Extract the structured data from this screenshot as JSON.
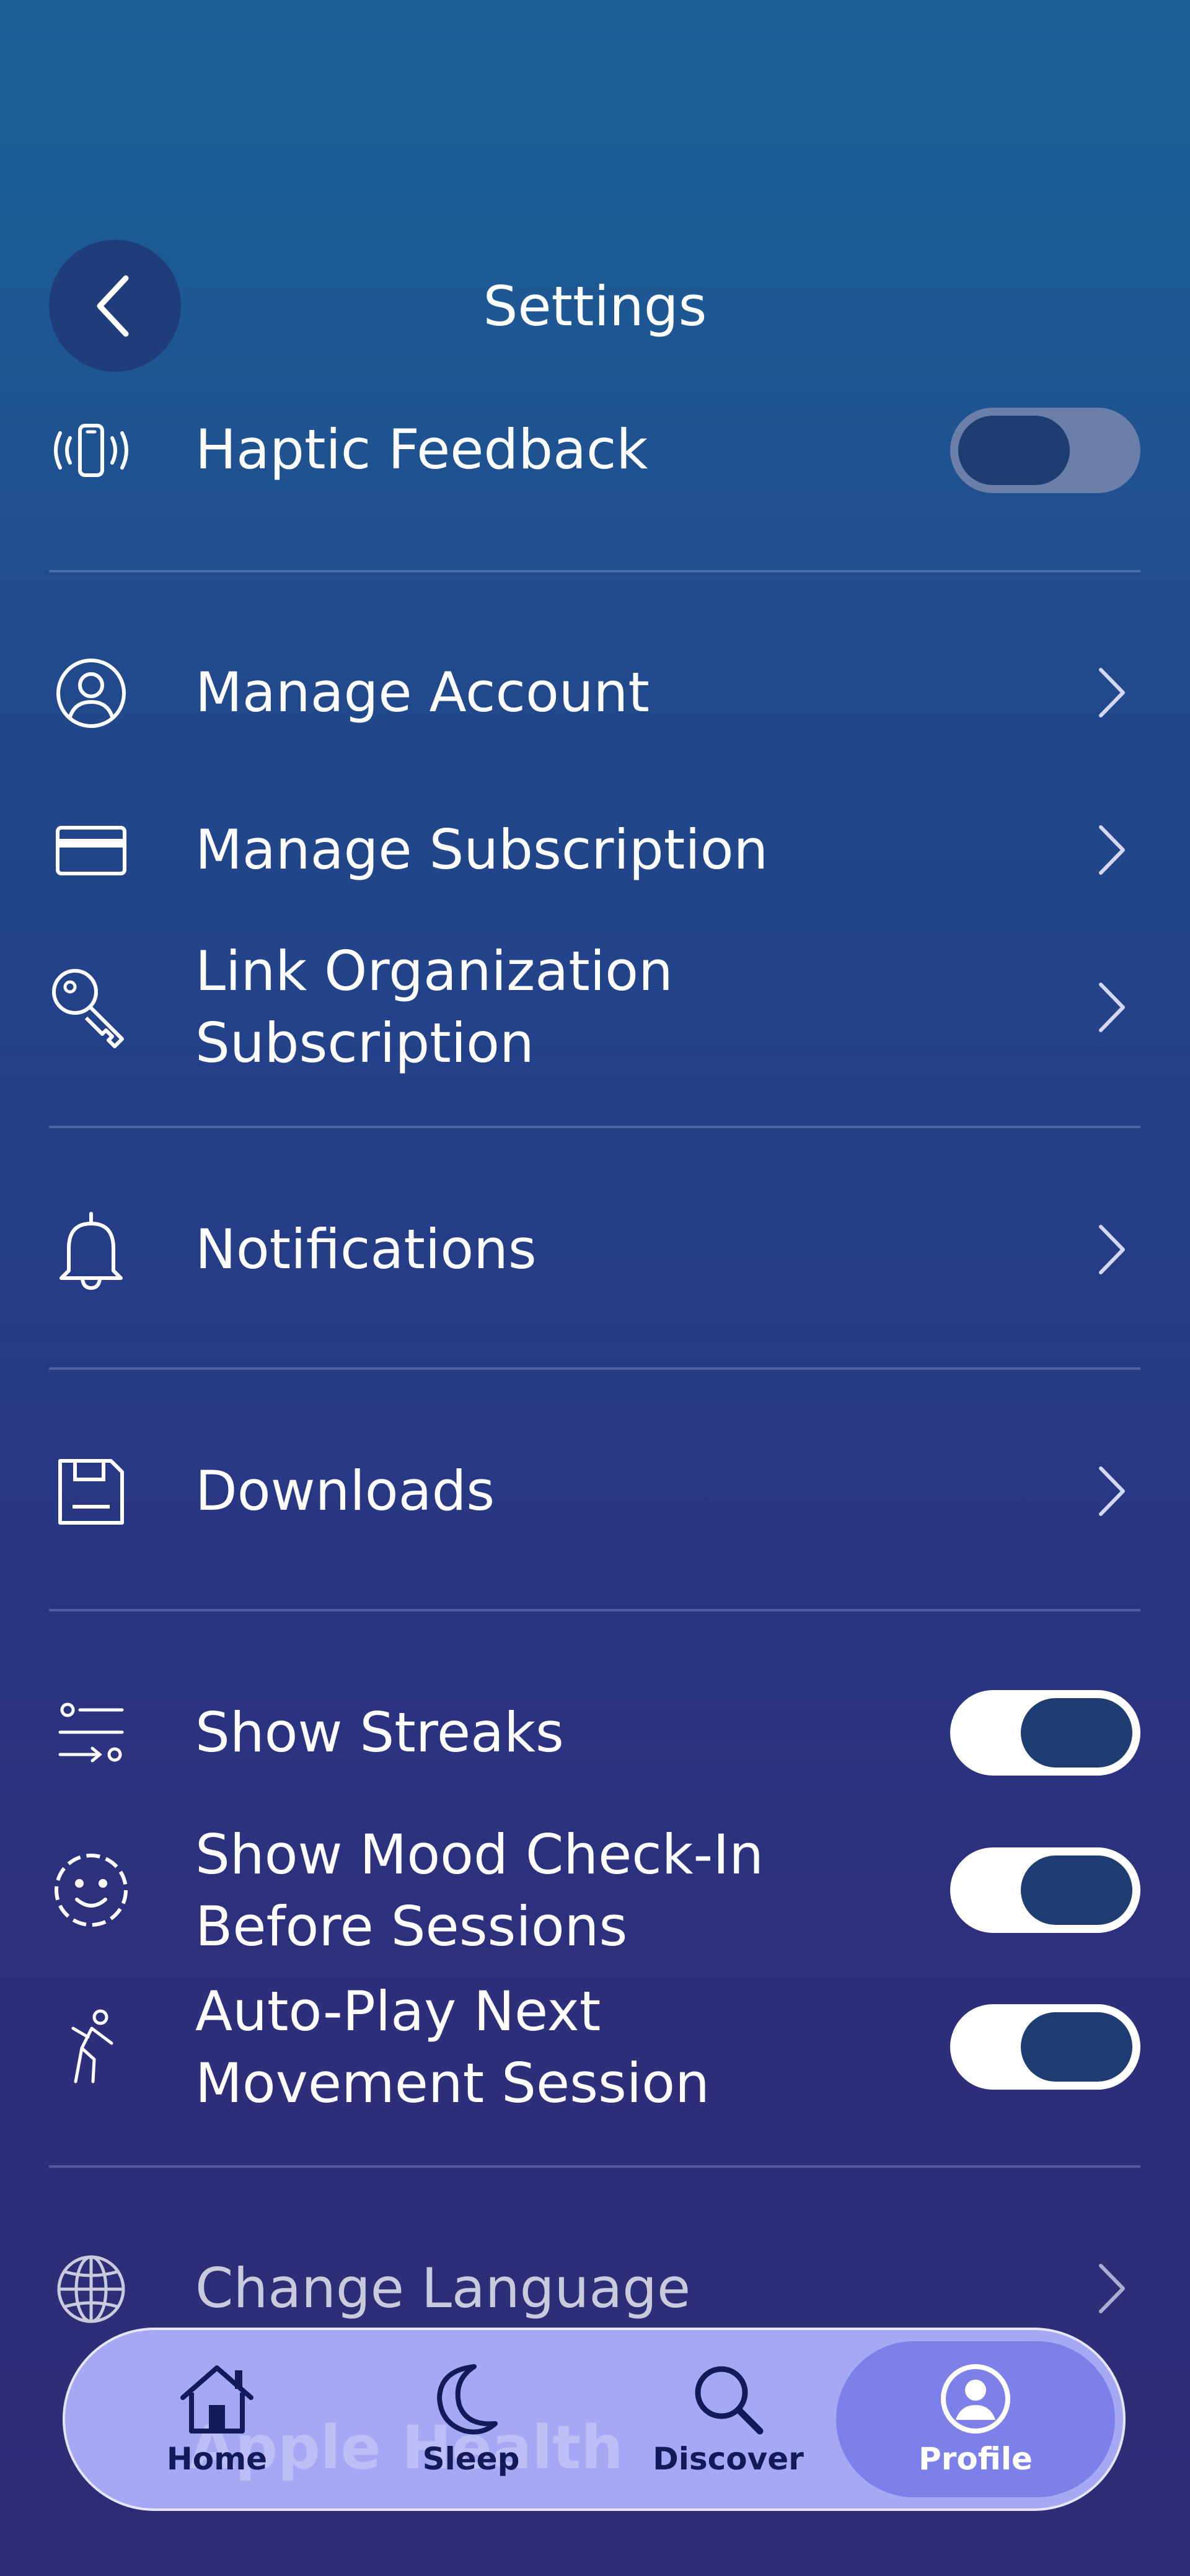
{
  "header": {
    "title": "Settings"
  },
  "rows": {
    "haptic": {
      "label": "Haptic Feedback",
      "toggle": "off"
    },
    "manage_account": {
      "label": "Manage Account"
    },
    "manage_subscription": {
      "label": "Manage Subscription"
    },
    "link_org": {
      "line1": "Link Organization",
      "line2": "Subscription"
    },
    "notifications": {
      "label": "Notifications"
    },
    "downloads": {
      "label": "Downloads"
    },
    "show_streaks": {
      "label": "Show Streaks",
      "toggle": "on"
    },
    "mood_checkin": {
      "line1": "Show Mood Check-In",
      "line2": "Before Sessions",
      "toggle": "on"
    },
    "autoplay": {
      "line1": "Auto-Play Next",
      "line2": "Movement Session",
      "toggle": "on"
    },
    "change_language": {
      "label": "Change Language"
    },
    "apple_health": {
      "label": "Apple Health"
    }
  },
  "tabbar": {
    "tabs": [
      {
        "label": "Home",
        "icon": "home-icon"
      },
      {
        "label": "Sleep",
        "icon": "moon-icon"
      },
      {
        "label": "Discover",
        "icon": "search-icon"
      },
      {
        "label": "Profile",
        "icon": "profile-icon",
        "active": true
      }
    ]
  },
  "colors": {
    "toggle_knob": "#1e3d72",
    "tab_active": "#7d80e9",
    "tabbar_bg": "#a7a8f3"
  }
}
